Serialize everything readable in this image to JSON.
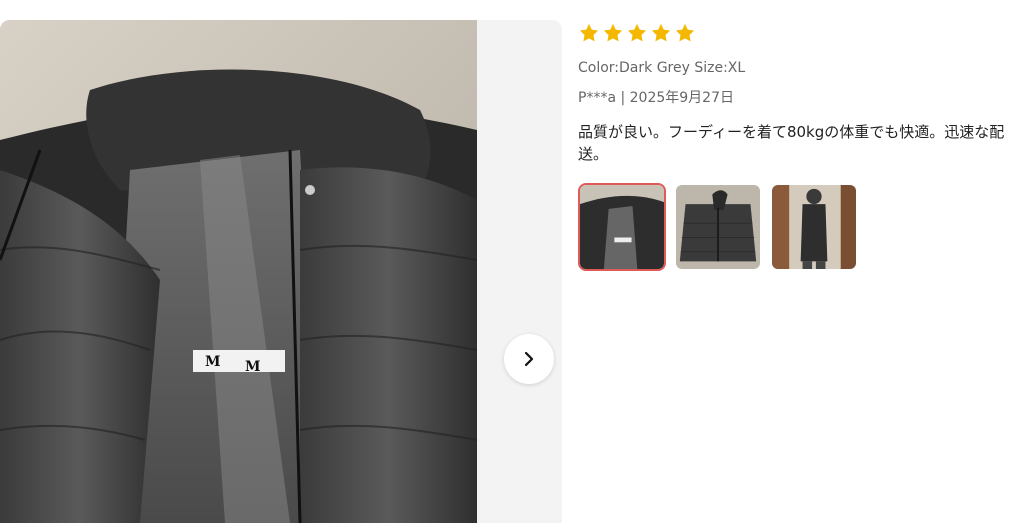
{
  "viewer": {
    "next_icon": "chevron-right-icon"
  },
  "review": {
    "rating": 5,
    "rating_max": 5,
    "star_color": "#f5b800",
    "variant": "Color:Dark Grey Size:XL",
    "author_date": "P***a | 2025年9月27日",
    "text": "品質が良い。フーディーを着て80kgの体重でも快適。迅速な配送。",
    "thumbnails": [
      {
        "alt": "jacket inside",
        "active": true
      },
      {
        "alt": "jacket flat",
        "active": false
      },
      {
        "alt": "jacket worn mirror",
        "active": false
      }
    ]
  },
  "photo": {
    "label_text": "M M"
  }
}
